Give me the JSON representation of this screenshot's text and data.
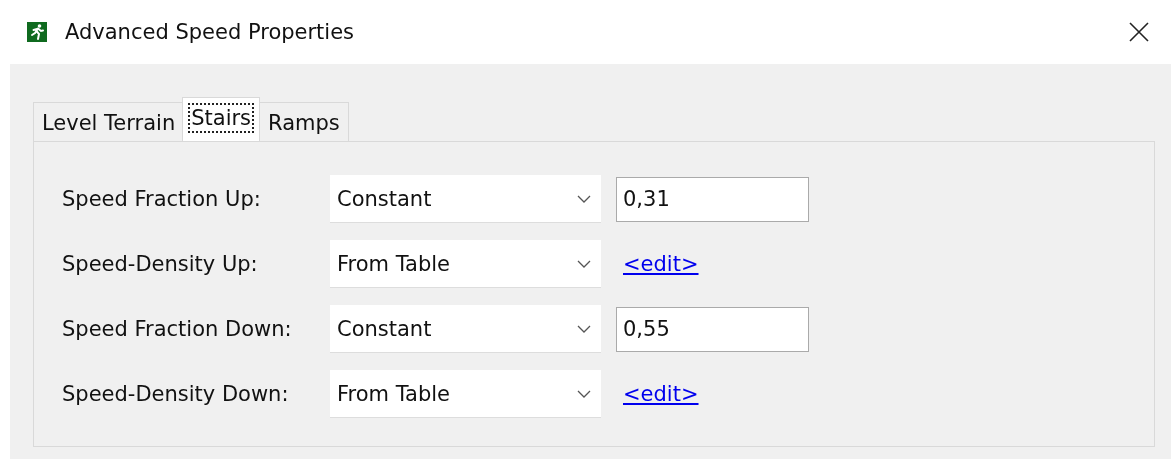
{
  "window": {
    "title": "Advanced Speed Properties"
  },
  "tabs": [
    {
      "label": "Level Terrain",
      "selected": false
    },
    {
      "label": "Stairs",
      "selected": true
    },
    {
      "label": "Ramps",
      "selected": false
    }
  ],
  "rows": [
    {
      "label": "Speed Fraction Up:",
      "dropdown": "Constant",
      "kind": "value",
      "value": "0,31"
    },
    {
      "label": "Speed-Density Up:",
      "dropdown": "From Table",
      "kind": "link",
      "link": "<edit>"
    },
    {
      "label": "Speed Fraction Down:",
      "dropdown": "Constant",
      "kind": "value",
      "value": "0,55"
    },
    {
      "label": "Speed-Density Down:",
      "dropdown": "From Table",
      "kind": "link",
      "link": "<edit>"
    }
  ]
}
